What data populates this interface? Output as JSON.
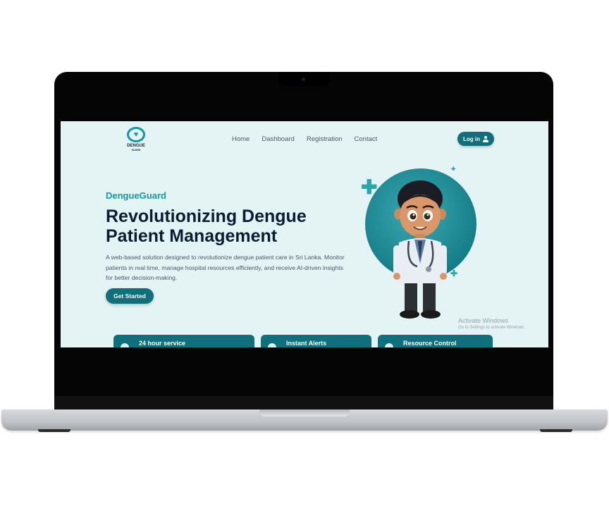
{
  "logo": {
    "title": "DENGUE",
    "subtitle": "GUARD"
  },
  "nav": {
    "items": [
      "Home",
      "Dashboard",
      "Registration",
      "Contact"
    ]
  },
  "login": {
    "label": "Log in"
  },
  "hero": {
    "brand": "DengueGuard",
    "headline_line1": "Revolutionizing Dengue",
    "headline_line2": "Patient Management",
    "description": "A web-based solution designed to revolutionize dengue patient care in Sri Lanka. Monitor patients in real time, manage hospital resources efficiently, and receive AI-driven insights for better decision-making.",
    "cta": "Get Started"
  },
  "watermark": {
    "line1": "Activate Windows",
    "line2": "Go to Settings to activate Windows."
  },
  "features": [
    {
      "label": "24 hour service",
      "icon": "clock-icon"
    },
    {
      "label": "Instant Alerts",
      "icon": "bell-icon"
    },
    {
      "label": "Resource Control",
      "icon": "check-icon"
    }
  ],
  "colors": {
    "accent": "#149aa3",
    "button": "#0f6f7a",
    "background": "#e4f3f4",
    "heading": "#0c1c33"
  }
}
